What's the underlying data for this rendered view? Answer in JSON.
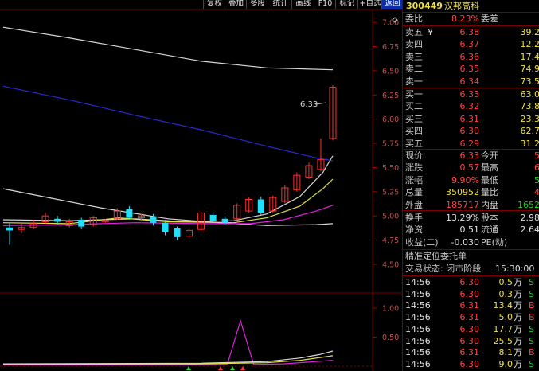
{
  "toolbar": {
    "items": [
      "复权",
      "叠加",
      "多股",
      "统计",
      "画线",
      "F10",
      "标记",
      "+自选",
      "返回"
    ]
  },
  "header": {
    "code": "300449",
    "name": "汉邦高科"
  },
  "weibi": {
    "label1": "委比",
    "value": "8.23%",
    "label2": "委差",
    "value2": ""
  },
  "asks": [
    {
      "label": "卖五",
      "price": "6.38",
      "vol": "39.2"
    },
    {
      "label": "卖四",
      "price": "6.37",
      "vol": "12.2"
    },
    {
      "label": "卖三",
      "price": "6.36",
      "vol": "17.4"
    },
    {
      "label": "卖二",
      "price": "6.35",
      "vol": "74.9"
    },
    {
      "label": "卖一",
      "price": "6.34",
      "vol": "73.5"
    }
  ],
  "ask_marker": "¥",
  "bids": [
    {
      "label": "买一",
      "price": "6.33",
      "vol": "63.0"
    },
    {
      "label": "买二",
      "price": "6.32",
      "vol": "73.8"
    },
    {
      "label": "买三",
      "price": "6.31",
      "vol": "23.3"
    },
    {
      "label": "买四",
      "price": "6.30",
      "vol": "62.7"
    },
    {
      "label": "买五",
      "price": "6.29",
      "vol": "31.2"
    }
  ],
  "stats": [
    {
      "l1": "现价",
      "v1": "6.33",
      "c1": "red",
      "l2": "今开",
      "v2": "5",
      "c2": "red"
    },
    {
      "l1": "涨跌",
      "v1": "0.57",
      "c1": "red",
      "l2": "最高",
      "v2": "6",
      "c2": "red"
    },
    {
      "l1": "涨幅",
      "v1": "9.90%",
      "c1": "red",
      "l2": "最低",
      "v2": "5",
      "c2": "grn"
    },
    {
      "l1": "总量",
      "v1": "350952",
      "c1": "yel",
      "l2": "量比",
      "v2": "4",
      "c2": "red"
    },
    {
      "l1": "外盘",
      "v1": "185717",
      "c1": "red",
      "l2": "内盘",
      "v2": "1652",
      "c2": "grn"
    }
  ],
  "stats2": [
    {
      "l1": "换手",
      "v1": "13.29%",
      "c1": "wht",
      "l2": "股本",
      "v2": "2.98"
    },
    {
      "l1": "净资",
      "v1": "0.51",
      "c1": "wht",
      "l2": "流通",
      "v2": "2.64"
    },
    {
      "l1": "收益(二)",
      "v1": "-0.030",
      "c1": "wht",
      "l2": "PE(动)",
      "v2": ""
    }
  ],
  "section_title": "精准定位委托单",
  "trade_status": {
    "label": "交易状态: 闭市阶段",
    "time": "15:30:00"
  },
  "ticks": [
    {
      "time": "14:56",
      "price": "6.30",
      "vol": "0.5",
      "unit": "万",
      "side": "S"
    },
    {
      "time": "14:56",
      "price": "6.30",
      "vol": "0.3",
      "unit": "万",
      "side": "S"
    },
    {
      "time": "14:56",
      "price": "6.31",
      "vol": "13.4",
      "unit": "万",
      "side": "B"
    },
    {
      "time": "14:56",
      "price": "6.31",
      "vol": "5.0",
      "unit": "万",
      "side": "B"
    },
    {
      "time": "14:56",
      "price": "6.30",
      "vol": "17.7",
      "unit": "万",
      "side": "S"
    },
    {
      "time": "14:56",
      "price": "6.30",
      "vol": "25.5",
      "unit": "万",
      "side": "S"
    },
    {
      "time": "14:56",
      "price": "6.31",
      "vol": "8.1",
      "unit": "万",
      "side": "B"
    },
    {
      "time": "14:56",
      "price": "6.30",
      "vol": "9.0",
      "unit": "万",
      "side": "S"
    }
  ],
  "chart_data": {
    "type": "candlestick",
    "price_axis": {
      "ticks": [
        "7.00",
        "6.75",
        "6.50",
        "6.25",
        "6.00",
        "5.75",
        "5.50",
        "5.25",
        "5.00",
        "4.75",
        "4.50"
      ],
      "range": [
        4.45,
        7.1
      ]
    },
    "volume_axis": {
      "ticks": [
        "1.00",
        "0.50"
      ],
      "range": [
        0,
        1.15
      ]
    },
    "high_label": "6.33",
    "candles": [
      {
        "o": 4.88,
        "c": 4.85,
        "h": 4.93,
        "l": 4.7
      },
      {
        "o": 4.86,
        "c": 4.88,
        "h": 4.92,
        "l": 4.82
      },
      {
        "o": 4.88,
        "c": 4.92,
        "h": 4.96,
        "l": 4.86
      },
      {
        "o": 4.94,
        "c": 5.0,
        "h": 5.03,
        "l": 4.92
      },
      {
        "o": 4.97,
        "c": 4.94,
        "h": 5.0,
        "l": 4.91
      },
      {
        "o": 4.9,
        "c": 4.94,
        "h": 4.97,
        "l": 4.88
      },
      {
        "o": 4.96,
        "c": 4.89,
        "h": 4.98,
        "l": 4.86
      },
      {
        "o": 4.91,
        "c": 4.98,
        "h": 5.0,
        "l": 4.89
      },
      {
        "o": 4.95,
        "c": 4.95,
        "h": 4.97,
        "l": 4.93
      },
      {
        "o": 4.97,
        "c": 5.05,
        "h": 5.08,
        "l": 4.96
      },
      {
        "o": 5.07,
        "c": 4.98,
        "h": 5.1,
        "l": 4.96
      },
      {
        "o": 4.98,
        "c": 5.0,
        "h": 5.02,
        "l": 4.96
      },
      {
        "o": 4.99,
        "c": 4.93,
        "h": 5.02,
        "l": 4.9
      },
      {
        "o": 4.93,
        "c": 4.83,
        "h": 4.96,
        "l": 4.8
      },
      {
        "o": 4.87,
        "c": 4.78,
        "h": 4.89,
        "l": 4.75
      },
      {
        "o": 4.79,
        "c": 4.85,
        "h": 4.88,
        "l": 4.76
      },
      {
        "o": 4.86,
        "c": 5.03,
        "h": 5.05,
        "l": 4.85
      },
      {
        "o": 5.01,
        "c": 4.95,
        "h": 5.04,
        "l": 4.93
      },
      {
        "o": 4.97,
        "c": 4.93,
        "h": 5.0,
        "l": 4.91
      },
      {
        "o": 4.97,
        "c": 5.11,
        "h": 5.13,
        "l": 4.95
      },
      {
        "o": 5.05,
        "c": 5.17,
        "h": 5.19,
        "l": 5.03
      },
      {
        "o": 5.17,
        "c": 5.03,
        "h": 5.2,
        "l": 5.01
      },
      {
        "o": 5.05,
        "c": 5.19,
        "h": 5.21,
        "l": 5.03
      },
      {
        "o": 5.15,
        "c": 5.29,
        "h": 5.32,
        "l": 5.13
      },
      {
        "o": 5.27,
        "c": 5.42,
        "h": 5.45,
        "l": 5.25
      },
      {
        "o": 5.4,
        "c": 5.52,
        "h": 5.55,
        "l": 5.38
      },
      {
        "o": 5.48,
        "c": 5.58,
        "h": 5.8,
        "l": 5.46
      },
      {
        "o": 5.8,
        "c": 6.33,
        "h": 6.35,
        "l": 5.78
      }
    ],
    "ma_lines": [
      {
        "color": "#d8d8d8",
        "points": [
          [
            0,
            6.95
          ],
          [
            0.2,
            6.84
          ],
          [
            0.4,
            6.72
          ],
          [
            0.6,
            6.6
          ],
          [
            0.8,
            6.53
          ],
          [
            1.0,
            6.51
          ]
        ]
      },
      {
        "color": "#2828d0",
        "points": [
          [
            0,
            6.34
          ],
          [
            0.2,
            6.2
          ],
          [
            0.4,
            6.04
          ],
          [
            0.6,
            5.89
          ],
          [
            0.8,
            5.72
          ],
          [
            0.95,
            5.6
          ],
          [
            1.0,
            5.57
          ]
        ]
      },
      {
        "color": "#d8d8d8",
        "points": [
          [
            0,
            5.28
          ],
          [
            0.12,
            5.2
          ],
          [
            0.3,
            5.08
          ],
          [
            0.5,
            4.97
          ],
          [
            0.65,
            4.93
          ],
          [
            0.8,
            4.9
          ],
          [
            0.95,
            4.91
          ],
          [
            1.0,
            4.92
          ]
        ]
      },
      {
        "color": "#d8d8d8",
        "points": [
          [
            0,
            4.96
          ],
          [
            0.2,
            4.95
          ],
          [
            0.4,
            4.97
          ],
          [
            0.55,
            4.94
          ],
          [
            0.7,
            4.95
          ],
          [
            0.8,
            5.02
          ],
          [
            0.9,
            5.2
          ],
          [
            0.97,
            5.45
          ],
          [
            1.0,
            5.62
          ]
        ]
      },
      {
        "color": "#e0e040",
        "points": [
          [
            0,
            4.93
          ],
          [
            0.2,
            4.92
          ],
          [
            0.35,
            4.98
          ],
          [
            0.5,
            4.94
          ],
          [
            0.7,
            4.93
          ],
          [
            0.8,
            4.98
          ],
          [
            0.9,
            5.1
          ],
          [
            0.97,
            5.28
          ],
          [
            1.0,
            5.38
          ]
        ]
      },
      {
        "color": "#e020e0",
        "points": [
          [
            0,
            4.9
          ],
          [
            0.2,
            4.91
          ],
          [
            0.4,
            4.93
          ],
          [
            0.6,
            4.92
          ],
          [
            0.75,
            4.92
          ],
          [
            0.85,
            4.96
          ],
          [
            0.95,
            5.05
          ],
          [
            1.0,
            5.11
          ]
        ]
      }
    ],
    "volume_lines": [
      {
        "color": "#e020e0",
        "points": [
          [
            0,
            0.02
          ],
          [
            0.68,
            0.03
          ],
          [
            0.72,
            0.78
          ],
          [
            0.76,
            0.03
          ],
          [
            0.85,
            0.04
          ],
          [
            0.95,
            0.08
          ],
          [
            1.0,
            0.1
          ]
        ]
      },
      {
        "color": "#d8d8d8",
        "points": [
          [
            0,
            0.04
          ],
          [
            0.6,
            0.05
          ],
          [
            0.8,
            0.08
          ],
          [
            0.9,
            0.14
          ],
          [
            0.96,
            0.2
          ],
          [
            1.0,
            0.26
          ]
        ]
      },
      {
        "color": "#e0e040",
        "points": [
          [
            0,
            0.03
          ],
          [
            0.6,
            0.04
          ],
          [
            0.8,
            0.06
          ],
          [
            0.9,
            0.1
          ],
          [
            1.0,
            0.18
          ]
        ]
      }
    ]
  }
}
